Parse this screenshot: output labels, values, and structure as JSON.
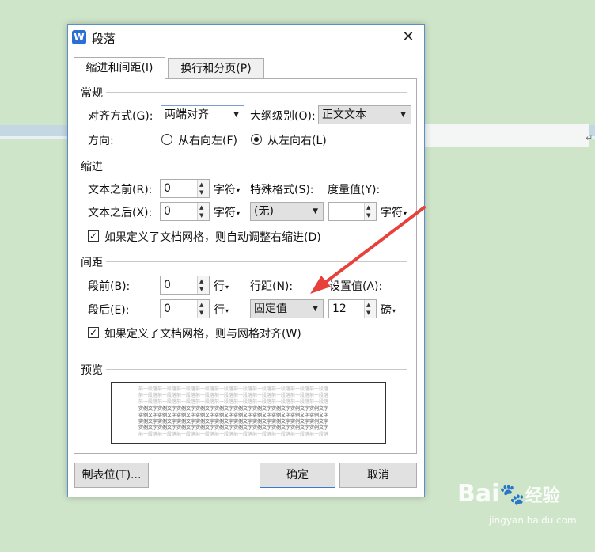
{
  "dialog": {
    "title": "段落",
    "close_glyph": "✕",
    "app_icon_letter": "W",
    "tabs": [
      "缩进和间距(I)",
      "换行和分页(P)"
    ]
  },
  "general": {
    "title": "常规",
    "align_label": "对齐方式(G):",
    "align_value": "两端对齐",
    "outline_label": "大纲级别(O):",
    "outline_value": "正文文本",
    "direction_label": "方向:",
    "rtl_label": "从右向左(F)",
    "ltr_label": "从左向右(L)",
    "direction_selected": "ltr"
  },
  "indent": {
    "title": "缩进",
    "before_label": "文本之前(R):",
    "before_value": "0",
    "before_unit": "字符",
    "after_label": "文本之后(X):",
    "after_value": "0",
    "after_unit": "字符",
    "special_label": "特殊格式(S):",
    "special_value": "(无)",
    "measure_label": "度量值(Y):",
    "measure_value": "",
    "measure_unit": "字符",
    "grid_checkbox": "如果定义了文档网格，则自动调整右缩进(D)",
    "grid_checked": true
  },
  "spacing": {
    "title": "间距",
    "before_label": "段前(B):",
    "before_value": "0",
    "before_unit": "行",
    "after_label": "段后(E):",
    "after_value": "0",
    "after_unit": "行",
    "line_label": "行距(N):",
    "line_value": "固定值",
    "set_label": "设置值(A):",
    "set_value": "12",
    "set_unit": "磅",
    "grid_checkbox": "如果定义了文档网格，则与网格对齐(W)",
    "grid_checked": true
  },
  "preview": {
    "title": "预览",
    "prev_text": "前一段落前一段落前一段落前一段落前一段落前一段落前一段落前一段落前一段落前一段落",
    "sample_text": "实例文字实例文字实例文字实例文字实例文字实例文字实例文字实例文字实例文字实例文字"
  },
  "buttons": {
    "tabs": "制表位(T)...",
    "ok": "确定",
    "cancel": "取消"
  },
  "watermark": {
    "brand": "Bai",
    "brand2": "经验",
    "url": "jingyan.baidu.com"
  },
  "annotation_color": "#e8413c"
}
